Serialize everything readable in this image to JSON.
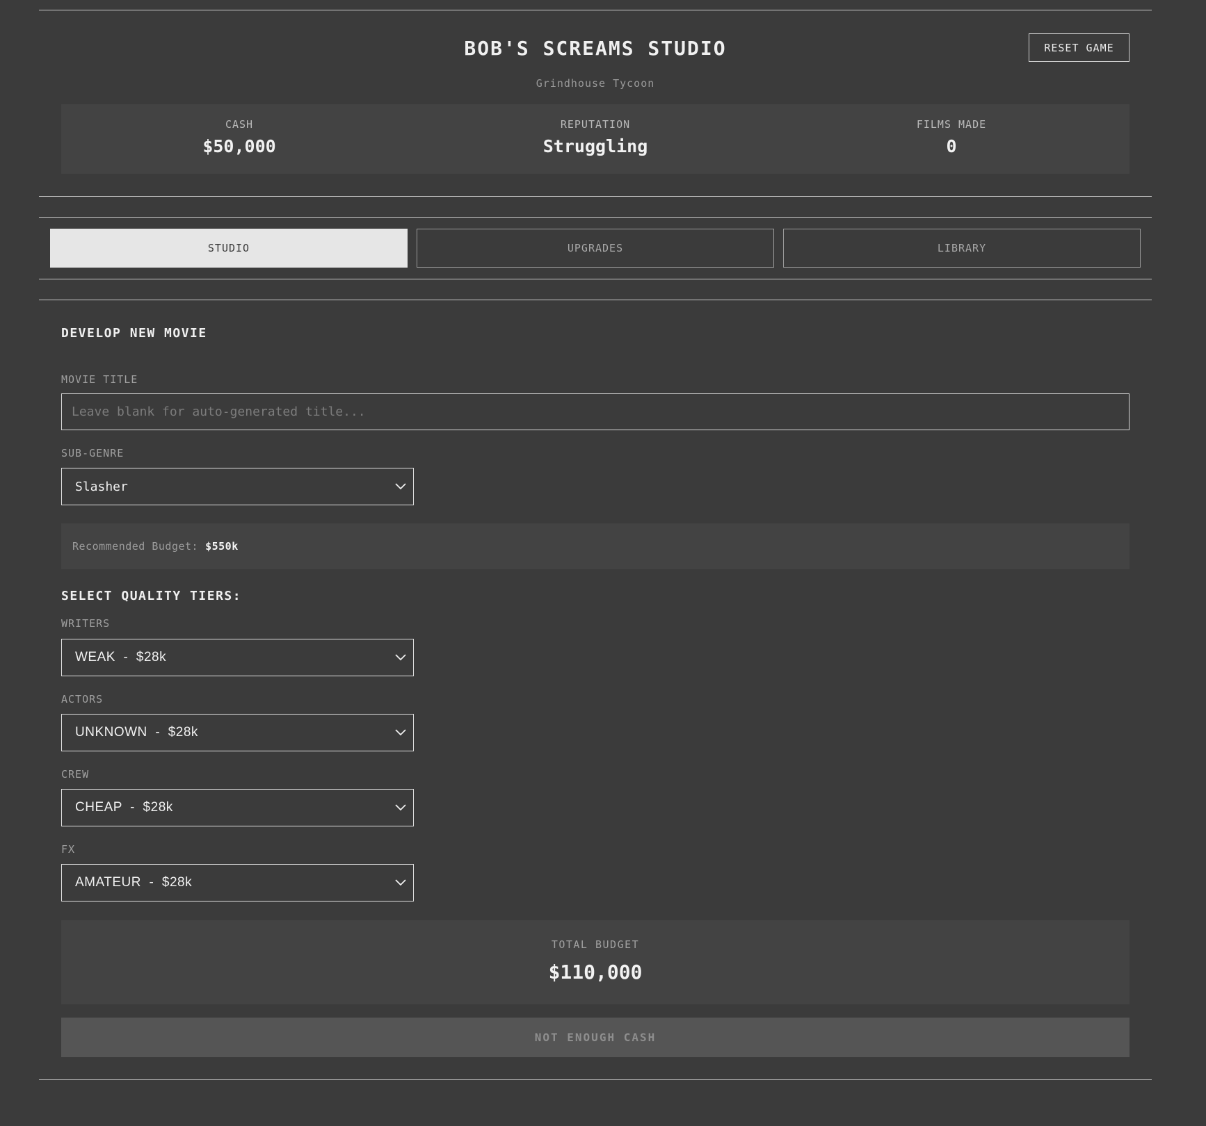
{
  "header": {
    "title": "BOB'S SCREAMS STUDIO",
    "subtitle": "Grindhouse Tycoon",
    "reset_label": "RESET GAME"
  },
  "stats": {
    "cash_label": "CASH",
    "cash_value": "$50,000",
    "reputation_label": "REPUTATION",
    "reputation_value": "Struggling",
    "films_label": "FILMS MADE",
    "films_value": "0"
  },
  "tabs": [
    {
      "label": "STUDIO",
      "active": true
    },
    {
      "label": "UPGRADES",
      "active": false
    },
    {
      "label": "LIBRARY",
      "active": false
    }
  ],
  "develop": {
    "section_title": "DEVELOP NEW MOVIE",
    "movie_title_label": "MOVIE TITLE",
    "movie_title_value": "",
    "movie_title_placeholder": "Leave blank for auto-generated title...",
    "subgenre_label": "SUB-GENRE",
    "subgenre_value": "Slasher",
    "recommended_label": "Recommended Budget:",
    "recommended_value": "$550k"
  },
  "quality": {
    "section_title": "SELECT QUALITY TIERS:",
    "writers_label": "WRITERS",
    "writers_value": "WEAK  -  $28k",
    "actors_label": "ACTORS",
    "actors_value": "UNKNOWN  -  $28k",
    "crew_label": "CREW",
    "crew_value": "CHEAP  -  $28k",
    "fx_label": "FX",
    "fx_value": "AMATEUR  -  $28k"
  },
  "budget": {
    "total_label": "TOTAL BUDGET",
    "total_value": "$110,000",
    "produce_label": "NOT ENOUGH CASH"
  },
  "colors": {
    "background": "#3b3b3b",
    "panel": "#434343",
    "active_tab": "#e6e6e6",
    "disabled_button": "#555555"
  }
}
